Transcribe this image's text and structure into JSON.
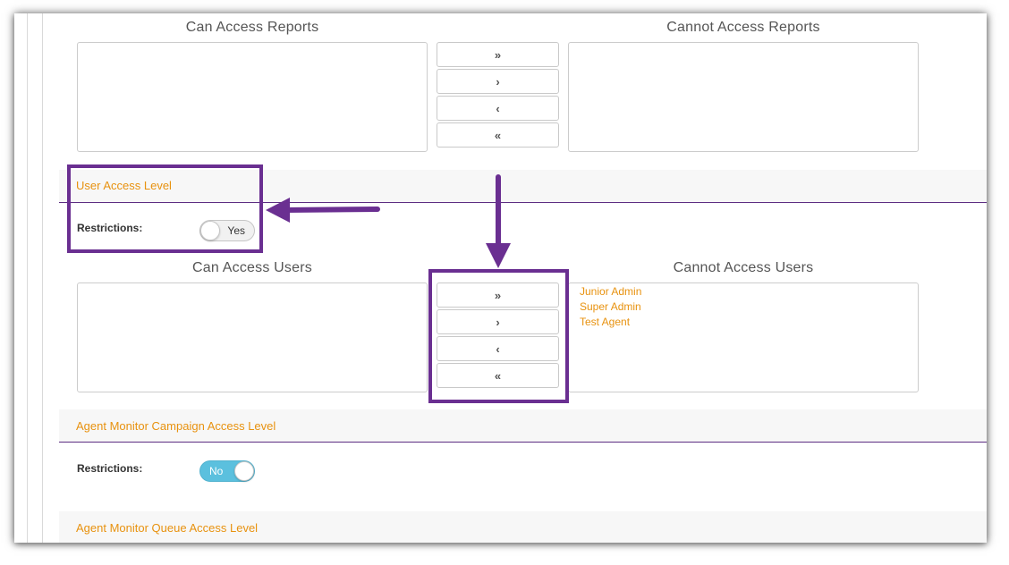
{
  "reports": {
    "can_title": "Can Access Reports",
    "cannot_title": "Cannot Access Reports",
    "can_items": [],
    "cannot_items": []
  },
  "transfer_buttons": {
    "move_all_right": "»",
    "move_right": "›",
    "move_left": "‹",
    "move_all_left": "«"
  },
  "user_access": {
    "section_title": "User Access Level",
    "restrictions_label": "Restrictions:",
    "toggle_text": "Yes",
    "can_title": "Can Access Users",
    "cannot_title": "Cannot Access Users",
    "can_items": [],
    "cannot_items": [
      "Junior Admin",
      "Super Admin",
      "Test Agent"
    ]
  },
  "campaign_access": {
    "section_title": "Agent Monitor Campaign Access Level",
    "restrictions_label": "Restrictions:",
    "toggle_text": "No"
  },
  "queue_access": {
    "section_title": "Agent Monitor Queue Access Level"
  },
  "colors": {
    "accent_orange": "#e8920f",
    "annotation_purple": "#6a2f91",
    "toggle_on": "#5bc0de"
  }
}
